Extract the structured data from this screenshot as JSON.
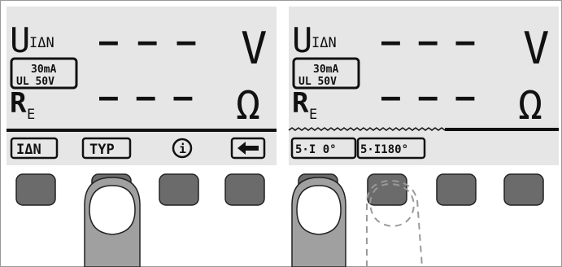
{
  "panels": [
    {
      "id": "left",
      "measure_top": {
        "symbol": "U",
        "subscript": "IΔN",
        "value": "– – –",
        "unit": "V"
      },
      "range_badge": {
        "line1": "30mA",
        "line2": "UL 50V"
      },
      "measure_bottom": {
        "symbol": "R",
        "subscript": "E",
        "value": "– – –",
        "unit": "Ω"
      },
      "softkeys": [
        "IΔN",
        "TYP",
        "i",
        "back-arrow"
      ],
      "pressed_key_index": 1
    },
    {
      "id": "right",
      "measure_top": {
        "symbol": "U",
        "subscript": "IΔN",
        "value": "– – –",
        "unit": "V"
      },
      "range_badge": {
        "line1": "30mA",
        "line2": "UL 50V"
      },
      "measure_bottom": {
        "symbol": "R",
        "subscript": "E",
        "value": "– – –",
        "unit": "Ω"
      },
      "softkeys": [
        "5·I 0°",
        "5·I180°"
      ],
      "pressed_key_index": 0,
      "ghost_key_index": 1
    }
  ],
  "colors": {
    "lcd_bg": "#e6e6e6",
    "text": "#111111",
    "button": "#6b6b6b",
    "finger_dark": "#a0a0a0",
    "finger_nail": "#ffffff",
    "ghost": "#9a9a9a"
  }
}
